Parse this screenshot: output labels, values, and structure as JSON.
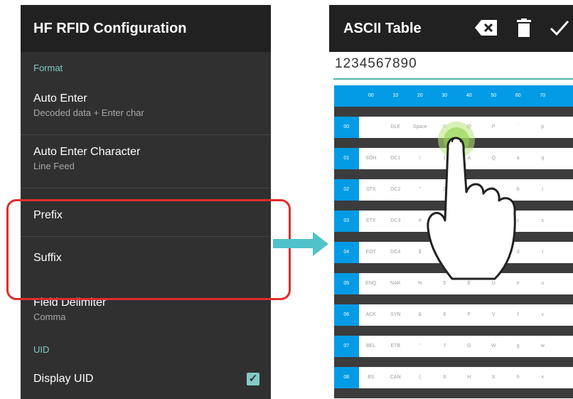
{
  "left": {
    "title": "HF RFID Configuration",
    "section_format": "Format",
    "auto_enter": {
      "title": "Auto Enter",
      "summary": "Decoded data + Enter char"
    },
    "auto_enter_char": {
      "title": "Auto Enter Character",
      "summary": "Line Feed"
    },
    "prefix": "Prefix",
    "suffix": "Suffix",
    "field_delimiter": {
      "title": "Field Delimiter",
      "summary": "Comma"
    },
    "section_uid": "UID",
    "display_uid": {
      "title": "Display UID",
      "checked": true
    }
  },
  "right": {
    "title": "ASCII Table",
    "input_value": "1234567890",
    "icons": [
      "backspace-icon",
      "trash-icon",
      "check-icon"
    ],
    "header": [
      "00",
      "10",
      "20",
      "30",
      "40",
      "50",
      "60",
      "70"
    ],
    "rows": [
      [
        "00",
        "",
        "DLE",
        "Space",
        "0",
        "@",
        "P",
        "`",
        "p"
      ],
      [
        "01",
        "SOH",
        "DC1",
        "!",
        "1",
        "A",
        "Q",
        "a",
        "q"
      ],
      [
        "02",
        "STX",
        "DC2",
        "\"",
        "2",
        "B",
        "R",
        "b",
        "r"
      ],
      [
        "03",
        "ETX",
        "DC3",
        "#",
        "3",
        "C",
        "S",
        "c",
        "s"
      ],
      [
        "04",
        "EOT",
        "DC4",
        "$",
        "4",
        "D",
        "T",
        "d",
        "t"
      ],
      [
        "05",
        "ENQ",
        "NAK",
        "%",
        "5",
        "E",
        "U",
        "e",
        "u"
      ],
      [
        "06",
        "ACK",
        "SYN",
        "&",
        "6",
        "F",
        "V",
        "f",
        "v"
      ],
      [
        "07",
        "BEL",
        "ETB",
        "'",
        "7",
        "G",
        "W",
        "g",
        "w"
      ],
      [
        "08",
        "BS",
        "CAN",
        "(",
        "8",
        "H",
        "X",
        "h",
        "x"
      ]
    ]
  },
  "colors": {
    "accent": "#80cbc4",
    "highlight": "#e02c2c",
    "table_header": "#039be5",
    "arrow": "#4fc3c8"
  }
}
